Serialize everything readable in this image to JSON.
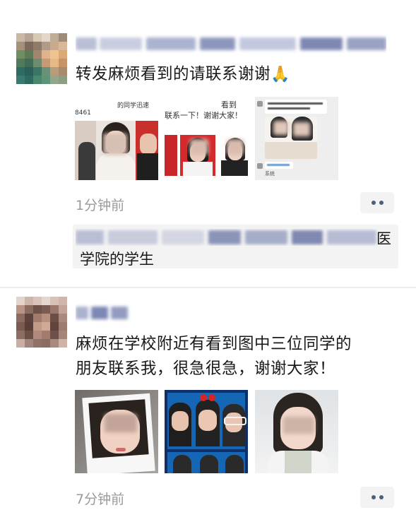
{
  "posts": [
    {
      "text": "转发麻烦看到的请联系谢谢",
      "emoji": "🙏",
      "time": "1分钟前",
      "images": [
        {
          "label": "group-photo",
          "caption_top": "的同学迅速",
          "caption_num": "8461"
        },
        {
          "label": "three-portraits",
          "caption_top": "看到",
          "caption_mid": "联系一下！谢谢大家！"
        },
        {
          "label": "chat-screenshot",
          "chat_label": "系统"
        }
      ],
      "comment": {
        "tail": "医",
        "line2": "学院的学生"
      }
    },
    {
      "text_line1": "麻烦在学校附近有看到图中三位同学的",
      "text_line2": "朋友联系我，很急很急，谢谢大家！",
      "time": "7分钟前",
      "images": [
        {
          "label": "polaroid-selfie"
        },
        {
          "label": "photobooth-strip"
        },
        {
          "label": "portrait-glasses-off"
        }
      ]
    }
  ],
  "colors": {
    "time_text": "#9a9a9a",
    "more_dots": "#4a5f80",
    "comment_bg": "#f3f3f3",
    "divider": "#ececec"
  },
  "icons": {
    "more": "two-dots-icon",
    "emoji": "pray-emoji"
  }
}
